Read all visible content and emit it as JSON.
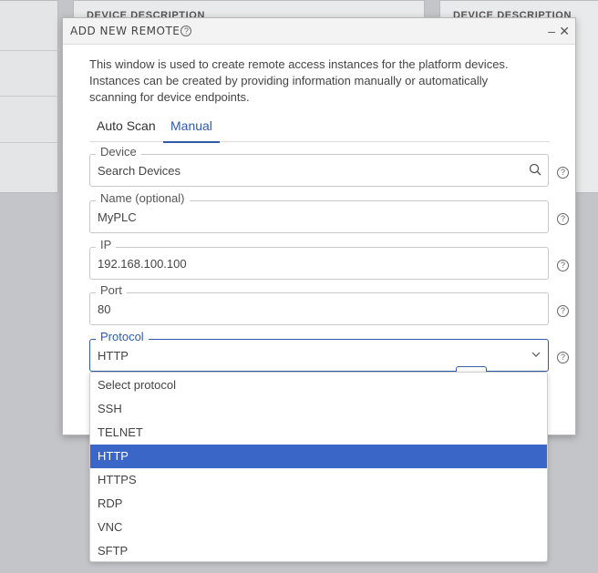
{
  "background": {
    "card_heading_mid": "DEVICE DESCRIPTION",
    "card_heading_right": "DEVICE DESCRIPTION"
  },
  "modal": {
    "title": "ADD NEW REMOTE",
    "title_help_glyph": "?",
    "minimize_glyph": "–",
    "close_glyph": "✕",
    "description": "This window is used to create remote access instances for the platform devices. Instances can be created by providing information manually or automatically scanning for device endpoints.",
    "tabs": [
      {
        "label": "Auto Scan",
        "active": false
      },
      {
        "label": "Manual",
        "active": true
      }
    ],
    "fields": {
      "device": {
        "label": "Device",
        "placeholder": "Search Devices"
      },
      "name": {
        "label": "Name (optional)",
        "value": "MyPLC"
      },
      "ip": {
        "label": "IP",
        "value": "192.168.100.100"
      },
      "port": {
        "label": "Port",
        "value": "80"
      },
      "protocol": {
        "label": "Protocol",
        "value": "HTTP"
      }
    },
    "help_glyph": "?"
  },
  "protocol_dropdown": {
    "placeholder": "Select protocol",
    "options": [
      "SSH",
      "TELNET",
      "HTTP",
      "HTTPS",
      "RDP",
      "VNC",
      "SFTP"
    ],
    "selected": "HTTP"
  },
  "colors": {
    "accent": "#2f5aa8",
    "selected_option_bg": "#3a66c8"
  }
}
